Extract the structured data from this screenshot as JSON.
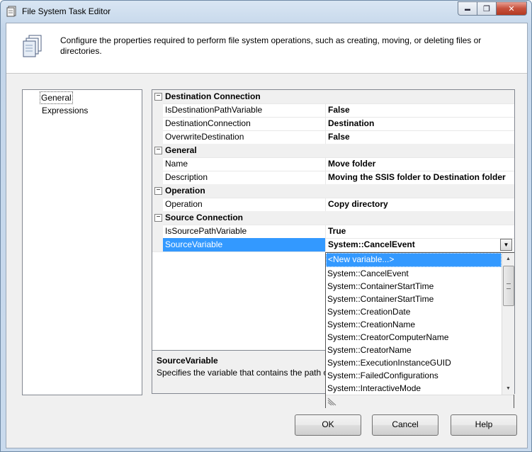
{
  "window": {
    "title": "File System Task Editor",
    "minimize_glyph": "▬",
    "maximize_glyph": "❐",
    "close_glyph": "✕"
  },
  "header": {
    "description": "Configure the properties required to perform file system operations, such as creating, moving, or deleting files or directories."
  },
  "nav": {
    "items": [
      {
        "label": "General",
        "selected": true
      },
      {
        "label": "Expressions",
        "selected": false
      }
    ]
  },
  "grid": {
    "collapse_glyph": "−",
    "categories": [
      {
        "label": "Destination Connection",
        "properties": [
          {
            "name": "IsDestinationPathVariable",
            "value": "False"
          },
          {
            "name": "DestinationConnection",
            "value": "Destination"
          },
          {
            "name": "OverwriteDestination",
            "value": "False"
          }
        ]
      },
      {
        "label": "General",
        "properties": [
          {
            "name": "Name",
            "value": "Move folder"
          },
          {
            "name": "Description",
            "value": "Moving the SSIS folder to Destination folder"
          }
        ]
      },
      {
        "label": "Operation",
        "properties": [
          {
            "name": "Operation",
            "value": "Copy directory"
          }
        ]
      },
      {
        "label": "Source Connection",
        "properties": [
          {
            "name": "IsSourcePathVariable",
            "value": "True"
          },
          {
            "name": "SourceVariable",
            "value": "System::CancelEvent",
            "selected": true
          }
        ]
      }
    ],
    "combo_arrow_glyph": "▼"
  },
  "description_panel": {
    "title": "SourceVariable",
    "text": "Specifies the variable that contains the path o"
  },
  "dropdown": {
    "items": [
      "<New variable...>",
      "System::CancelEvent",
      "System::ContainerStartTime",
      "System::ContainerStartTime",
      "System::CreationDate",
      "System::CreationName",
      "System::CreatorComputerName",
      "System::CreatorName",
      "System::ExecutionInstanceGUID",
      "System::FailedConfigurations",
      "System::InteractiveMode"
    ],
    "highlighted_index": 0,
    "scroll_up_glyph": "▲",
    "scroll_down_glyph": "▼"
  },
  "buttons": {
    "ok": "OK",
    "cancel": "Cancel",
    "help": "Help"
  }
}
